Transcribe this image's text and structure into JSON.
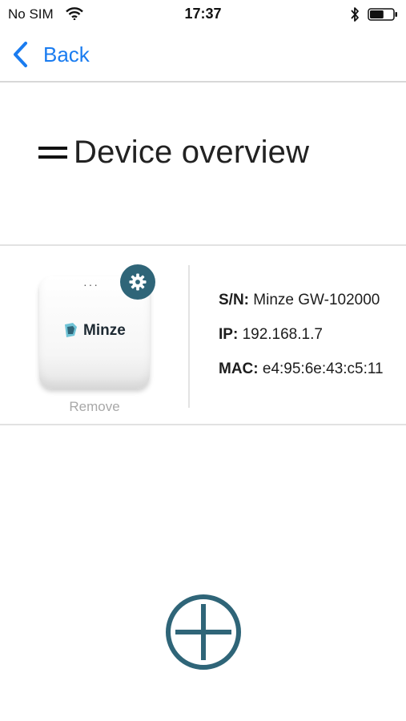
{
  "status_bar": {
    "carrier": "No SIM",
    "time": "17:37",
    "battery_level": 0.6
  },
  "nav": {
    "back_label": "Back"
  },
  "page": {
    "title": "Device overview"
  },
  "device": {
    "brand": "Minze",
    "remove_label": "Remove",
    "sn_label": "S/N:",
    "sn_value": "Minze GW-102000",
    "ip_label": "IP:",
    "ip_value": "192.168.1.7",
    "mac_label": "MAC:",
    "mac_value": "e4:95:6e:43:c5:11"
  },
  "colors": {
    "accent_blue": "#1a7cf0",
    "brand_teal": "#2f6578",
    "divider": "#e2e2e2"
  },
  "icons": {
    "back": "chevron-left-icon",
    "menu": "equals-menu-icon",
    "settings": "gear-icon",
    "add": "plus-circle-icon"
  }
}
